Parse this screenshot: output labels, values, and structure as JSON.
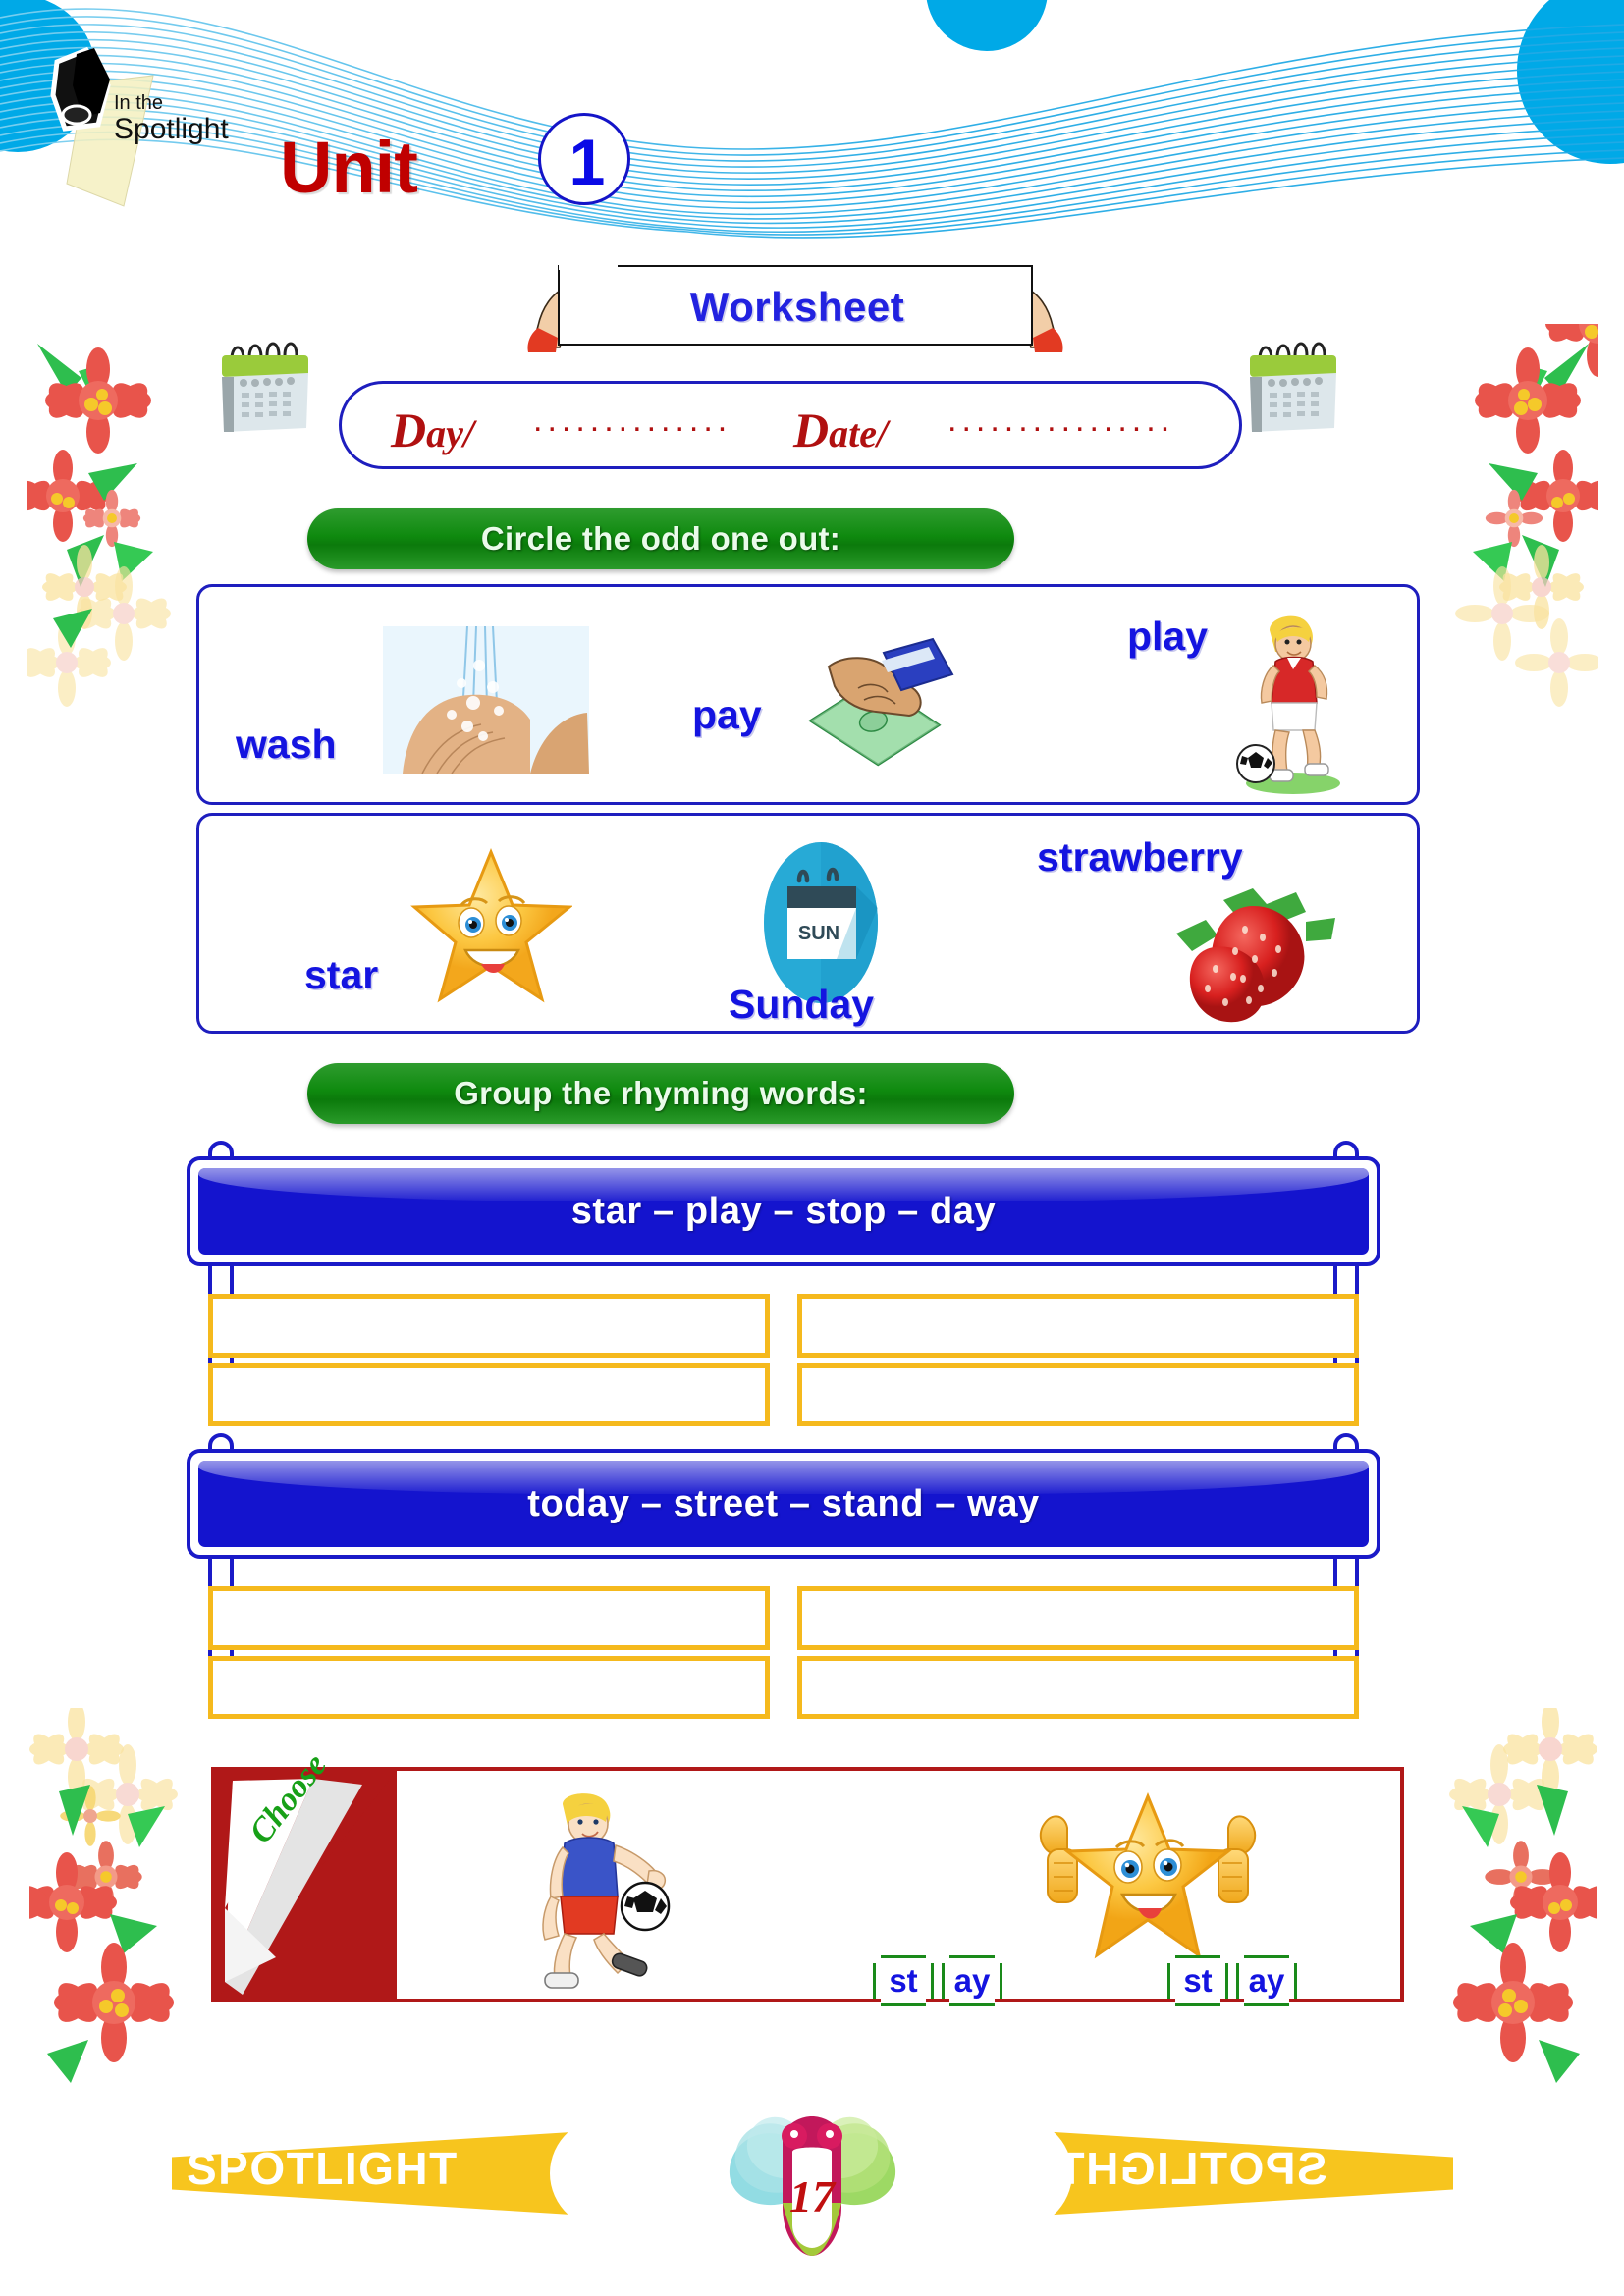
{
  "header": {
    "logo_line1": "In the",
    "logo_line2": "Spotlight",
    "unit_word": "Unit",
    "unit_number": "1"
  },
  "worksheet": {
    "title": "Worksheet"
  },
  "daydate": {
    "day_cap": "D",
    "day_rest": "ay/",
    "day_dots": "..............",
    "date_cap": "D",
    "date_rest": "ate/",
    "date_dots": "................"
  },
  "exercise1": {
    "instruction": "Circle the odd one out:",
    "rows": [
      {
        "items": [
          {
            "word": "wash",
            "icon": "washing-hands-icon"
          },
          {
            "word": "pay",
            "icon": "hand-with-money-icon"
          },
          {
            "word": "play",
            "icon": "boy-playing-football-icon"
          }
        ]
      },
      {
        "items": [
          {
            "word": "star",
            "icon": "smiling-star-icon"
          },
          {
            "word": "Sunday",
            "icon": "calendar-sunday-icon",
            "calendar_label": "SUN"
          },
          {
            "word": "strawberry",
            "icon": "strawberries-icon"
          }
        ]
      }
    ]
  },
  "exercise2": {
    "instruction": "Group the rhyming words:",
    "signs": [
      {
        "words": "star – play – stop – day",
        "columns": 2,
        "rows": 2
      },
      {
        "words": "today – street – stand – way",
        "columns": 2,
        "rows": 2
      }
    ]
  },
  "exercise3": {
    "label": "Choose",
    "items": [
      {
        "icon": "boy-playing-football-icon",
        "tiles": [
          "st",
          "ay"
        ]
      },
      {
        "icon": "star-thumbs-up-icon",
        "tiles": [
          "st",
          "ay"
        ]
      }
    ]
  },
  "footer": {
    "brand_left": "SPOTLIGHT",
    "brand_right": "SPOTLIGHT",
    "page_number": "17"
  },
  "colors": {
    "accent_blue": "#1414E0",
    "instruction_green": "#0F8A0F",
    "unit_red": "#C00000",
    "answer_gold": "#F5B91D",
    "choose_red": "#B01818",
    "footer_yellow": "#F7C51E",
    "wave_blue": "#23AAE5"
  }
}
